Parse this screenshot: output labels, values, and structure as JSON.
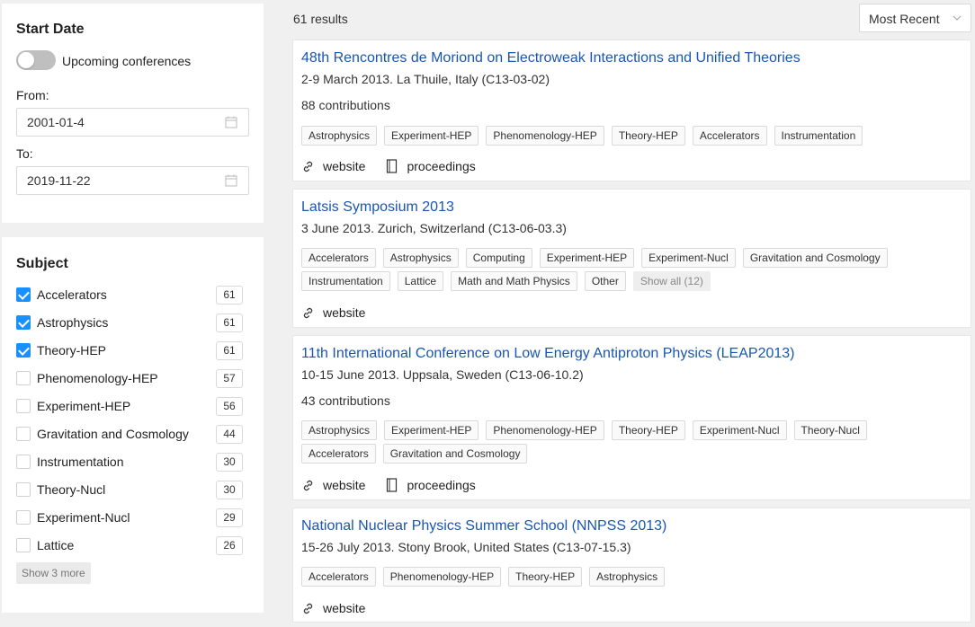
{
  "filters": {
    "start_date": {
      "title": "Start Date",
      "upcoming_label": "Upcoming conferences",
      "from_label": "From:",
      "from_value": "2001-01-4",
      "to_label": "To:",
      "to_value": "2019-11-22"
    },
    "subject": {
      "title": "Subject",
      "items": [
        {
          "label": "Accelerators",
          "count": "61",
          "checked": true
        },
        {
          "label": "Astrophysics",
          "count": "61",
          "checked": true
        },
        {
          "label": "Theory-HEP",
          "count": "61",
          "checked": true
        },
        {
          "label": "Phenomenology-HEP",
          "count": "57",
          "checked": false
        },
        {
          "label": "Experiment-HEP",
          "count": "56",
          "checked": false
        },
        {
          "label": "Gravitation and Cosmology",
          "count": "44",
          "checked": false
        },
        {
          "label": "Instrumentation",
          "count": "30",
          "checked": false
        },
        {
          "label": "Theory-Nucl",
          "count": "30",
          "checked": false
        },
        {
          "label": "Experiment-Nucl",
          "count": "29",
          "checked": false
        },
        {
          "label": "Lattice",
          "count": "26",
          "checked": false
        }
      ],
      "show_more": "Show 3 more"
    }
  },
  "results": {
    "count_text": "61 results",
    "sort_value": "Most Recent",
    "items": [
      {
        "title": "48th Rencontres de Moriond on Electroweak Interactions and Unified Theories",
        "subtitle": "2-9 March 2013. La Thuile, Italy (C13-03-02)",
        "contributions": "88 contributions",
        "tags": [
          "Astrophysics",
          "Experiment-HEP",
          "Phenomenology-HEP",
          "Theory-HEP",
          "Accelerators",
          "Instrumentation"
        ],
        "website": "website",
        "proceedings": "proceedings"
      },
      {
        "title": "Latsis Symposium 2013",
        "subtitle": "3 June 2013. Zurich, Switzerland (C13-06-03.3)",
        "tags_row1": [
          "Accelerators",
          "Astrophysics",
          "Computing",
          "Experiment-HEP",
          "Experiment-Nucl",
          "Gravitation and Cosmology"
        ],
        "tags_row2": [
          "Instrumentation",
          "Lattice",
          "Math and Math Physics",
          "Other"
        ],
        "show_all": "Show all (12)",
        "website": "website"
      },
      {
        "title": "11th International Conference on Low Energy Antiproton Physics (LEAP2013)",
        "subtitle": "10-15 June 2013. Uppsala, Sweden (C13-06-10.2)",
        "contributions": "43 contributions",
        "tags_row1": [
          "Astrophysics",
          "Experiment-HEP",
          "Phenomenology-HEP",
          "Theory-HEP",
          "Experiment-Nucl",
          "Theory-Nucl"
        ],
        "tags_row2": [
          "Accelerators",
          "Gravitation and Cosmology"
        ],
        "website": "website",
        "proceedings": "proceedings"
      },
      {
        "title": "National Nuclear Physics Summer School (NNPSS 2013)",
        "subtitle": "15-26 July 2013. Stony Brook, United States (C13-07-15.3)",
        "tags": [
          "Accelerators",
          "Phenomenology-HEP",
          "Theory-HEP",
          "Astrophysics"
        ],
        "website": "website"
      }
    ]
  }
}
